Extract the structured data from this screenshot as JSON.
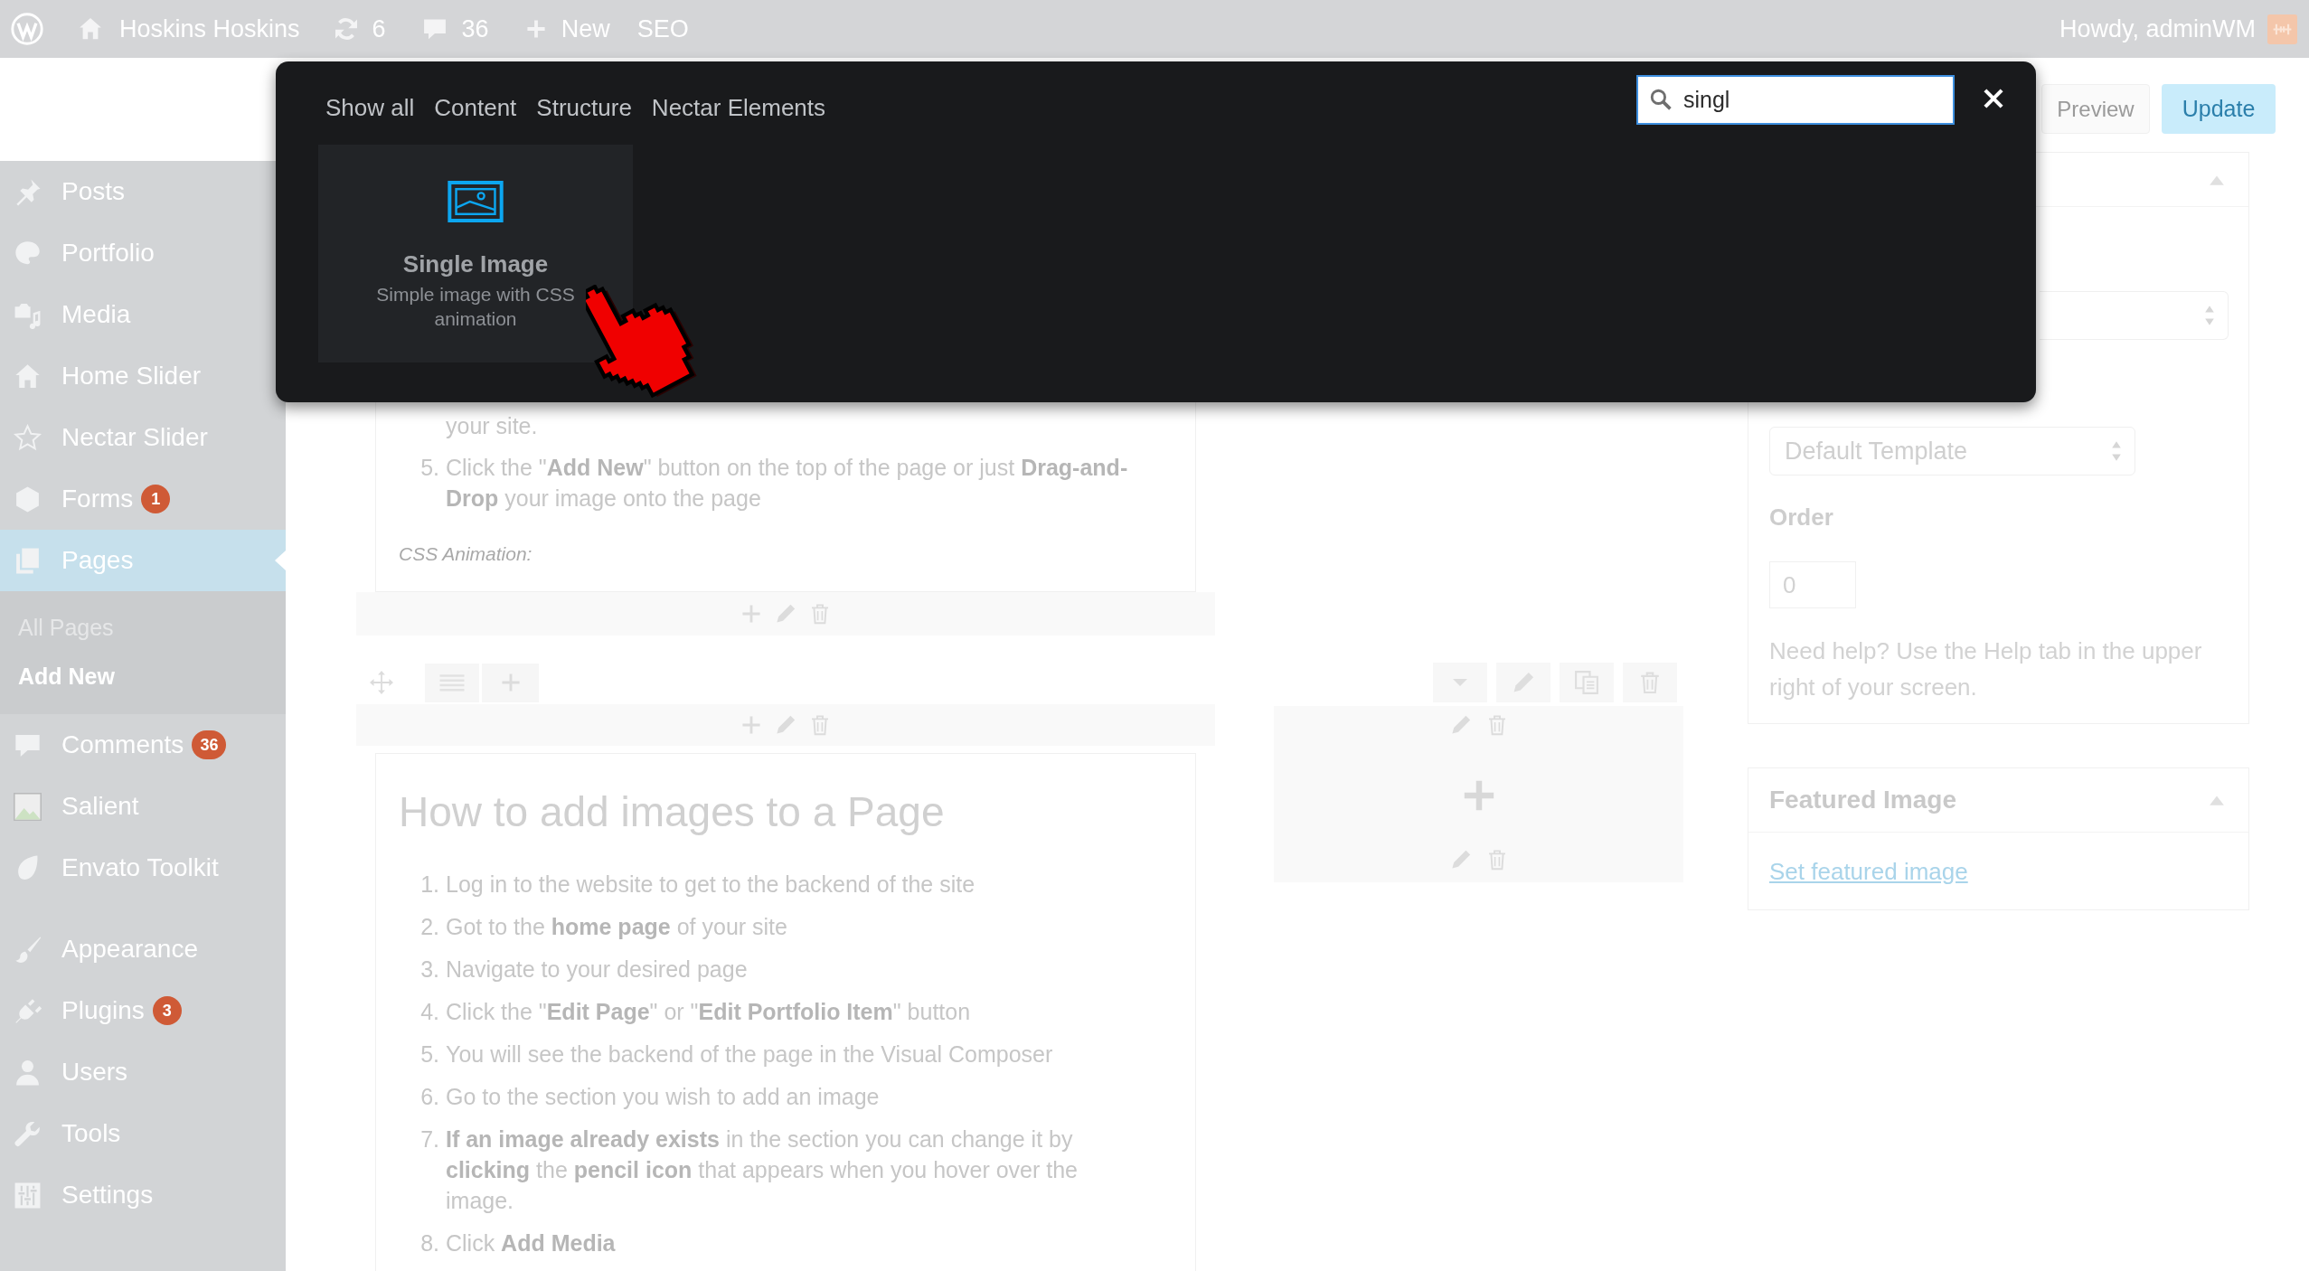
{
  "admin_bar": {
    "site": "Hoskins Hoskins",
    "updates": "6",
    "comments": "36",
    "new": "New",
    "seo": "SEO",
    "greeting": "Howdy, adminWM"
  },
  "sidebar": {
    "groups": [
      {
        "items": [
          {
            "label": "Posts",
            "selected": false
          },
          {
            "label": "Portfolio",
            "selected": false
          },
          {
            "label": "Media",
            "selected": false
          },
          {
            "label": "Home Slider",
            "selected": false
          },
          {
            "label": "Nectar Slider",
            "selected": false
          },
          {
            "label": "Forms",
            "badge": "1",
            "selected": false
          },
          {
            "label": "Pages",
            "selected": true,
            "children": [
              {
                "label": "All Pages",
                "selected": false
              },
              {
                "label": "Add New",
                "selected": true
              }
            ]
          },
          {
            "label": "Comments",
            "badge": "36",
            "selected": false
          },
          {
            "label": "Salient",
            "selected": false
          },
          {
            "label": "Envato Toolkit",
            "selected": false
          }
        ]
      },
      {
        "items": [
          {
            "label": "Appearance",
            "selected": false
          },
          {
            "label": "Plugins",
            "badge": "3",
            "selected": false
          },
          {
            "label": "Users",
            "selected": false
          },
          {
            "label": "Tools",
            "selected": false
          },
          {
            "label": "Settings",
            "selected": false
          }
        ]
      }
    ]
  },
  "header_buttons": [
    {
      "label": "Preview",
      "kind": "secondary"
    },
    {
      "label": "Update",
      "kind": "primary"
    }
  ],
  "editor": {
    "text_block": {
      "items": [
        {
          "text": "your site."
        },
        {
          "number": "5.",
          "text": "Click the \"**Add New**\" button on the top of the page or just **Drag-and-Drop** your image onto the page"
        }
      ],
      "animation_label": "CSS Animation:"
    },
    "content_block": {
      "heading": "How to add images to a Page",
      "items": [
        {
          "number": "1.",
          "text": "Log in to the website to get to the backend of the site"
        },
        {
          "number": "2.",
          "text": "Got to the **home page** of your site"
        },
        {
          "number": "3.",
          "text": "Navigate to your desired page"
        },
        {
          "number": "4.",
          "text": "Click the \"**Edit Page**\" or \"**Edit Portfolio Item**\" button"
        },
        {
          "number": "5.",
          "text": "You will see the backend of the page in the Visual Composer"
        },
        {
          "number": "6.",
          "text": "Go to the section you wish to add an image"
        },
        {
          "number": "7.",
          "text": "**If an image already exists** in the section you can change it by **clicking** the **pencil icon** that appears when you hover over the image."
        },
        {
          "number": "8.",
          "text": "Click **Add Media**"
        }
      ]
    }
  },
  "page_attributes": {
    "template": "Default Template",
    "order_label": "Order",
    "order": "0",
    "help": "Need help? Use the Help tab in the upper right of your screen."
  },
  "featured_image": {
    "title": "Featured Image",
    "link": "Set featured image"
  },
  "modal": {
    "tabs": [
      {
        "label": "Show all",
        "selected": false
      },
      {
        "label": "Content",
        "selected": false
      },
      {
        "label": "Structure",
        "selected": false
      },
      {
        "label": "Nectar Elements",
        "selected": false
      }
    ],
    "search": {
      "value": "singl"
    },
    "elements": [
      {
        "title": "Single Image",
        "description": "Simple image with CSS animation"
      }
    ]
  }
}
